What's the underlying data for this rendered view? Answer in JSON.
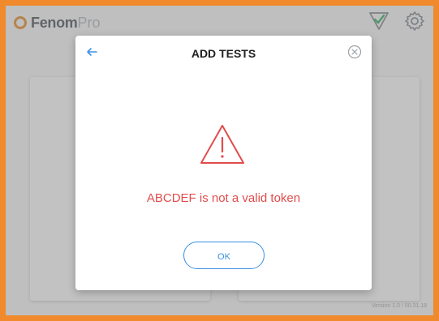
{
  "app": {
    "brand_main": "Fenom",
    "brand_sub": "Pro",
    "logo_icon": "ring-logo-icon",
    "status_icon": "check-triangle-icon",
    "settings_icon": "gear-icon"
  },
  "footer": {
    "version": "Version 1.0 / 00.31.18"
  },
  "modal": {
    "title": "ADD TESTS",
    "back_icon": "arrow-left-icon",
    "close_icon": "close-circle-icon",
    "warning_icon": "warning-triangle-icon",
    "message": "ABCDEF is not a valid token",
    "ok_label": "OK"
  },
  "colors": {
    "frame_border": "#f08a2c",
    "accent": "#3a90e5",
    "error": "#e04c4c",
    "check": "#3bb86a"
  }
}
